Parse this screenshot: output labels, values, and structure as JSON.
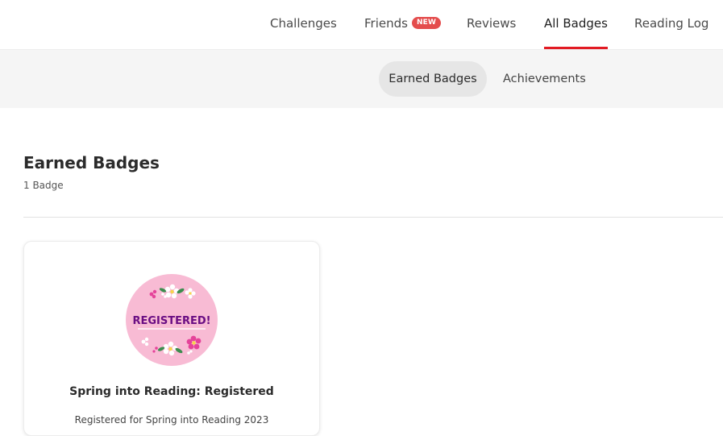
{
  "nav": {
    "items": [
      {
        "label": "Challenges"
      },
      {
        "label": "Friends",
        "badge": "NEW"
      },
      {
        "label": "Reviews"
      },
      {
        "label": "All Badges",
        "active": true
      },
      {
        "label": "Reading Log"
      }
    ]
  },
  "subnav": {
    "tabs": [
      {
        "label": "Earned Badges",
        "active": true
      },
      {
        "label": "Achievements"
      }
    ]
  },
  "section": {
    "title": "Earned Badges",
    "count": "1 Badge"
  },
  "badges": [
    {
      "title": "Spring into Reading: Registered",
      "description": "Registered for Spring into Reading 2023",
      "image_text": "REGISTERED!",
      "icon": "registered-flower-badge-icon"
    }
  ],
  "colors": {
    "accent": "#e21b23",
    "new_badge": "#e44d4d",
    "badge_pink": "#f8bbd4",
    "badge_text": "#6a0d83"
  }
}
